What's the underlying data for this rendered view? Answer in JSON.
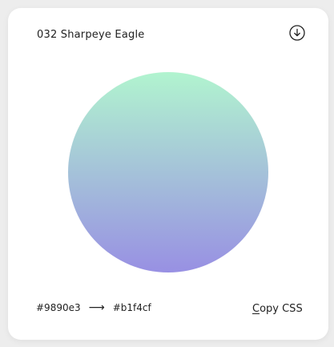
{
  "card": {
    "title": "032 Sharpeye Eagle"
  },
  "icons": {
    "download": "download-circle-icon"
  },
  "gradient": {
    "from": "#9890e3",
    "to": "#b1f4cf",
    "arrow": "⟶"
  },
  "actions": {
    "copy_css_first": "C",
    "copy_css_rest": "opy CSS"
  },
  "colors": {
    "background": "#ededed",
    "card": "#ffffff",
    "text": "#222222"
  }
}
